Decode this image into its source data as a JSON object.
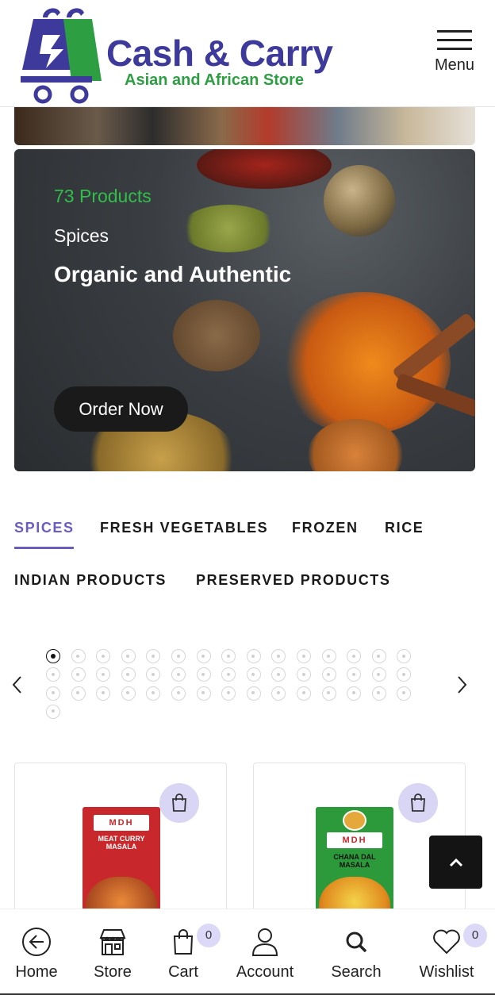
{
  "header": {
    "brand_name": "Cash & Carry",
    "brand_tagline": "Asian and African Store",
    "menu_label": "Menu"
  },
  "hero": {
    "product_count": "73 Products",
    "category": "Spices",
    "title": "Organic and Authentic",
    "cta_label": "Order Now"
  },
  "tabs": [
    {
      "label": "SPICES",
      "active": true
    },
    {
      "label": "FRESH VEGETABLES",
      "active": false
    },
    {
      "label": "FROZEN",
      "active": false
    },
    {
      "label": "RICE",
      "active": false
    },
    {
      "label": "INDIAN PRODUCTS",
      "active": false
    },
    {
      "label": "PRESERVED PRODUCTS",
      "active": false
    }
  ],
  "carousel": {
    "page_count": 46,
    "current_page": 1
  },
  "products": [
    {
      "brand": "MDH",
      "name": "MEAT CURRY MASALA"
    },
    {
      "brand": "MDH",
      "name": "CHANA DAL MASALA"
    }
  ],
  "bottom_nav": {
    "home": "Home",
    "store": "Store",
    "cart": "Cart",
    "cart_count": "0",
    "account": "Account",
    "search": "Search",
    "wishlist": "Wishlist",
    "wishlist_count": "0"
  },
  "colors": {
    "brand_blue": "#3d3a9c",
    "brand_green": "#2e9e43",
    "accent_purple": "#6b5cc0",
    "badge_bg": "#dcd8f7"
  }
}
